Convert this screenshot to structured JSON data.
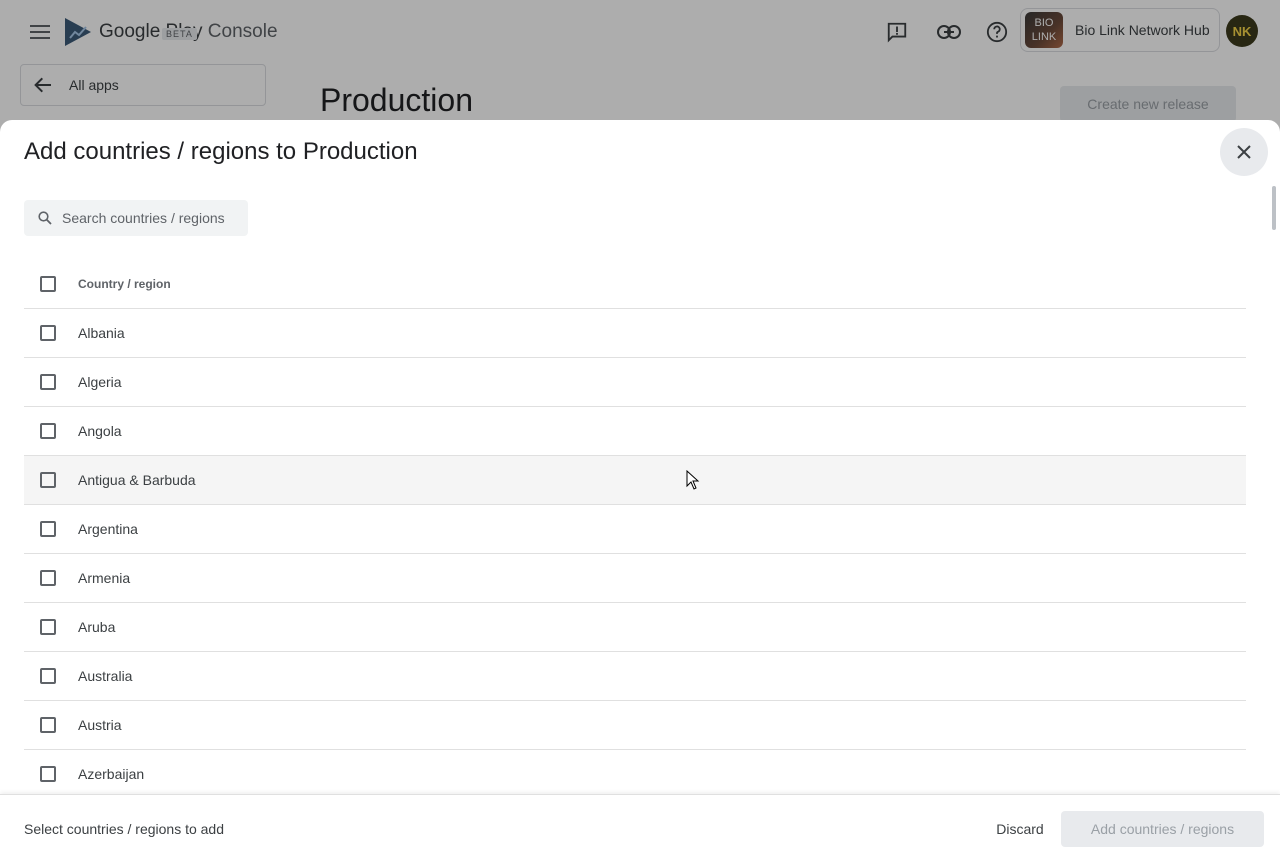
{
  "app": {
    "logo_text_main": "Google Play",
    "logo_text_suffix": " Console",
    "beta_label": "BETA",
    "account_logo_line1": "BIO",
    "account_logo_line2": "LINK",
    "account_name": "Bio Link Network Hub",
    "avatar_initials": "NK",
    "all_apps_label": "All apps",
    "page_title": "Production",
    "create_release_label": "Create new release"
  },
  "dialog": {
    "title": "Add countries / regions to Production",
    "search_placeholder": "Search countries / regions",
    "column_header": "Country / region",
    "rows": [
      {
        "name": "Albania"
      },
      {
        "name": "Algeria"
      },
      {
        "name": "Angola"
      },
      {
        "name": "Antigua & Barbuda"
      },
      {
        "name": "Argentina"
      },
      {
        "name": "Armenia"
      },
      {
        "name": "Aruba"
      },
      {
        "name": "Australia"
      },
      {
        "name": "Austria"
      },
      {
        "name": "Azerbaijan"
      }
    ],
    "footer_hint": "Select countries / regions to add",
    "discard_label": "Discard",
    "add_label": "Add countries / regions"
  },
  "icons": {
    "menu": "menu-icon",
    "feedback": "feedback-icon",
    "link": "link-icon",
    "help": "help-icon",
    "back": "arrow-back-icon",
    "close": "close-icon",
    "search": "search-icon"
  },
  "colors": {
    "brand_text": "#5f6368",
    "disabled_button_bg": "#e8eaed",
    "disabled_button_text": "#9aa0a6",
    "hover_row": "#f5f5f5",
    "avatar_bg": "#3c3a1c",
    "avatar_fg": "#f7d64a"
  }
}
